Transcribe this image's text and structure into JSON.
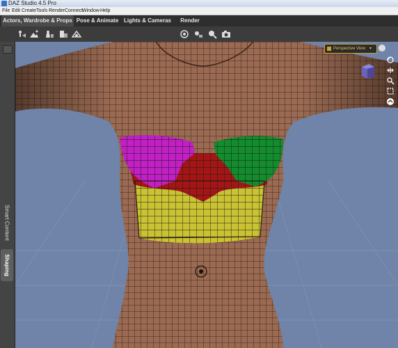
{
  "window": {
    "title": "DAZ Studio 4.5 Pro"
  },
  "menu": [
    "File",
    "Edit",
    "Create",
    "Tools",
    "Render",
    "Connect",
    "Window",
    "Help"
  ],
  "tabs": [
    {
      "label": "Actors, Wardrobe & Props",
      "active": true
    },
    {
      "label": "Pose & Animate",
      "active": false
    },
    {
      "label": "Lights & Cameras",
      "active": false
    },
    {
      "label": "Render",
      "active": false
    }
  ],
  "side_tabs": {
    "smart_content": "Smart Content",
    "shaping": "Shaping"
  },
  "viewport": {
    "view_label": "Perspective View",
    "background_color": "#6f84a8"
  },
  "colors": {
    "skin": "#9a6a52",
    "wire": "#2a1810",
    "region_magenta": "#c21fc5",
    "region_green": "#138c2e",
    "region_red": "#a31616",
    "region_yellow": "#c9c232",
    "accent": "#c8a335"
  },
  "icons": [
    "figure-icon",
    "terrain-icon",
    "primitive-icon",
    "wardrobe-icon",
    "scene-icon",
    "spot-render-icon",
    "render-settings-icon",
    "camera-icon",
    "camera-orbit-icon",
    "camera-dolly-icon",
    "camera-pan-icon",
    "camera-zoom-icon",
    "frame-icon",
    "home-icon"
  ]
}
